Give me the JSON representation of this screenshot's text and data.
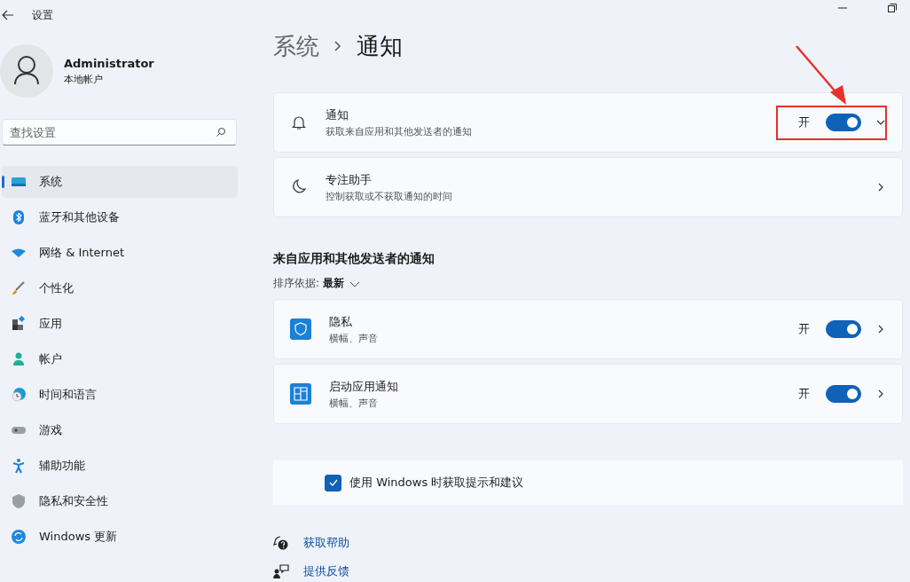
{
  "window": {
    "title": "设置"
  },
  "account": {
    "name": "Administrator",
    "type": "本地帐户"
  },
  "search": {
    "placeholder": "查找设置"
  },
  "sidebar": {
    "items": [
      {
        "label": "系统",
        "kind": "system",
        "selected": true
      },
      {
        "label": "蓝牙和其他设备",
        "kind": "bluetooth",
        "selected": false
      },
      {
        "label": "网络 & Internet",
        "kind": "network",
        "selected": false
      },
      {
        "label": "个性化",
        "kind": "personalize",
        "selected": false
      },
      {
        "label": "应用",
        "kind": "apps",
        "selected": false
      },
      {
        "label": "帐户",
        "kind": "account",
        "selected": false
      },
      {
        "label": "时间和语言",
        "kind": "time",
        "selected": false
      },
      {
        "label": "游戏",
        "kind": "gaming",
        "selected": false
      },
      {
        "label": "辅助功能",
        "kind": "accessibility",
        "selected": false
      },
      {
        "label": "隐私和安全性",
        "kind": "privacy",
        "selected": false
      },
      {
        "label": "Windows 更新",
        "kind": "update",
        "selected": false
      }
    ]
  },
  "breadcrumb": {
    "parent": "系统",
    "current": "通知"
  },
  "settings": [
    {
      "title": "通知",
      "subtitle": "获取来自应用和其他发送者的通知",
      "kind": "toggle",
      "state_label": "开",
      "on": true
    },
    {
      "title": "专注助手",
      "subtitle": "控制获取或不获取通知的时间",
      "kind": "link"
    }
  ],
  "apps_section": {
    "heading": "来自应用和其他发送者的通知",
    "sort_label": "排序依据:",
    "sort_value": "最新",
    "apps": [
      {
        "name": "隐私",
        "subtitle": "横幅、声音",
        "kind": "shield",
        "state_label": "开",
        "on": true
      },
      {
        "name": "启动应用通知",
        "subtitle": "横幅、声音",
        "kind": "tiles",
        "state_label": "开",
        "on": true
      }
    ]
  },
  "tips": {
    "label": "使用 Windows 时获取提示和建议",
    "checked": true
  },
  "links": [
    {
      "label": "获取帮助",
      "kind": "help"
    },
    {
      "label": "提供反馈",
      "kind": "feedback"
    }
  ]
}
